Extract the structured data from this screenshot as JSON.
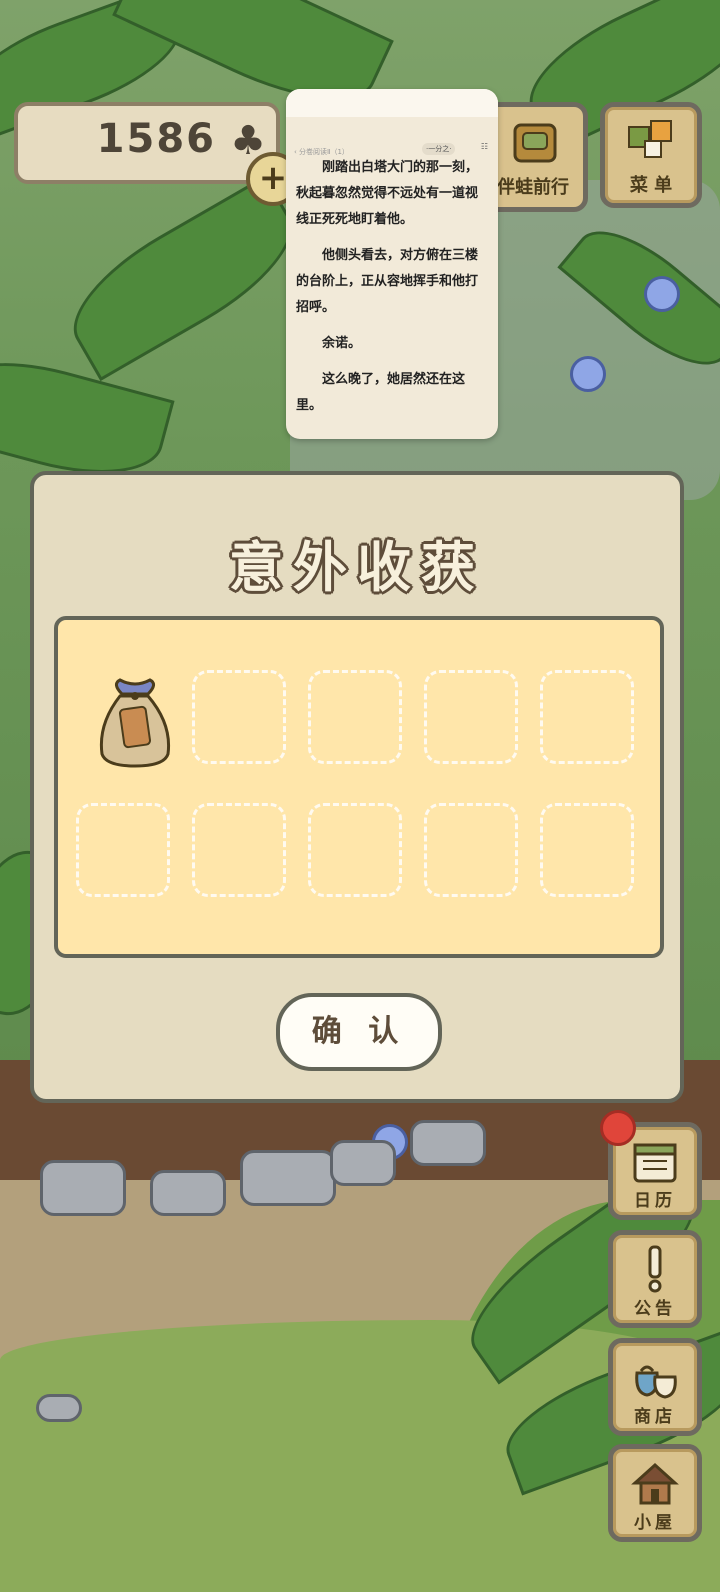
{
  "hud": {
    "clover_count": "1586",
    "clover_icon": "♣",
    "plus_label": "+"
  },
  "top_buttons": {
    "frog_travel_label": "伴蛙前行",
    "menu_label": "菜 单"
  },
  "reader_popup": {
    "nav_text": "‹ 分卷阅读Ⅱ（1）",
    "meta_text": "·一分之·",
    "menu_glyph": "☷",
    "paragraphs": [
      "刚踏出白塔大门的那一刻，秋起暮忽然觉得不远处有一道视线正死死地盯着他。",
      "他侧头看去，对方俯在三楼的台阶上，正从容地挥手和他打招呼。",
      "余诺。",
      "这么晚了，她居然还在这里。"
    ]
  },
  "reward_dialog": {
    "title": "意外收获",
    "items": [
      {
        "slot": 1,
        "icon": "seed-bag-icon",
        "filled": true
      },
      {
        "slot": 2,
        "filled": false
      },
      {
        "slot": 3,
        "filled": false
      },
      {
        "slot": 4,
        "filled": false
      },
      {
        "slot": 5,
        "filled": false
      },
      {
        "slot": 6,
        "filled": false
      },
      {
        "slot": 7,
        "filled": false
      },
      {
        "slot": 8,
        "filled": false
      },
      {
        "slot": 9,
        "filled": false
      },
      {
        "slot": 10,
        "filled": false
      }
    ],
    "confirm_label": "确 认"
  },
  "side_buttons": {
    "calendar_label": "日历",
    "notice_label": "公告",
    "shop_label": "商店",
    "house_label": "小屋"
  },
  "colors": {
    "dialog_bg": "#e5dcc1",
    "items_panel_bg": "#ffe6aa",
    "border": "#636558",
    "button_wood": "#d9c28d",
    "badge_red": "#e0453a"
  }
}
